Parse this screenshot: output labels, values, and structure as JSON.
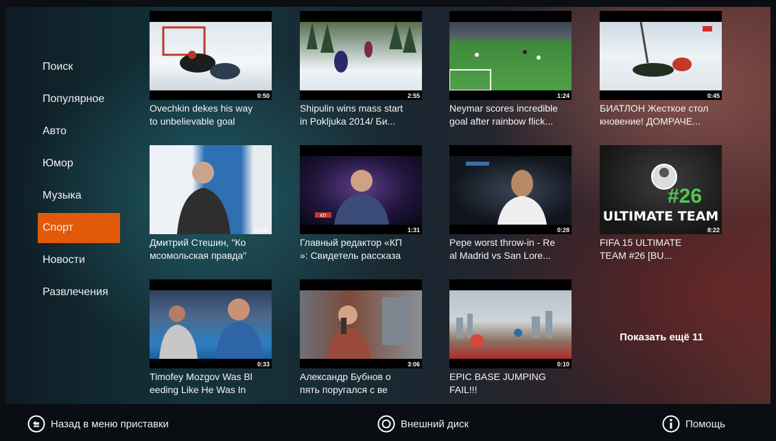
{
  "menu": {
    "items": [
      "Поиск",
      "Популярное",
      "Авто",
      "Юмор",
      "Музыка",
      "Спорт",
      "Новости",
      "Развлечения"
    ],
    "active": "Спорт"
  },
  "videos": [
    {
      "title1": "Ovechkin dekes his way",
      "title2": "to unbelievable goal",
      "duration": "0:50"
    },
    {
      "title1": "Shipulin wins mass start",
      "title2": "in Pokljuka 2014/ Би...",
      "duration": "2:55"
    },
    {
      "title1": "Neymar scores incredible",
      "title2": "goal after rainbow flick...",
      "duration": "1:24"
    },
    {
      "title1": "БИАТЛОН Жесткое стол",
      "title2": "кновение! ДОМРАЧЕ...",
      "duration": "0:45"
    },
    {
      "title1": "Дмитрий Стешин, \"Ко",
      "title2": "мсомольская правда\"",
      "duration": "11:01"
    },
    {
      "title1": "Главный редактор «КП",
      "title2": "»: Свидетель рассказа",
      "duration": "1:31"
    },
    {
      "title1": "Pepe worst throw-in - Re",
      "title2": "al Madrid vs San Lore...",
      "duration": "0:28"
    },
    {
      "title1": "FIFA 15 ULTIMATE",
      "title2": "TEAM #26 [BU...",
      "duration": "8:22"
    },
    {
      "title1": "Timofey Mozgov Was Bl",
      "title2": "eeding Like He Was In",
      "duration": "0:33"
    },
    {
      "title1": "Александр Бубнов о",
      "title2": "пять поругался с ве",
      "duration": "3:06"
    },
    {
      "title1": "EPIC BASE JUMPING",
      "title2": "FAIL!!!",
      "duration": "0:10"
    }
  ],
  "thumb_art": {
    "fifa_number": "#26",
    "fifa_text": "ULTIMATE TEAM",
    "ticker_text": "КП"
  },
  "show_more": "Показать ещё 11",
  "bottom": {
    "back": "Назад в меню приставки",
    "disk": "Внешний диск",
    "help": "Помощь"
  },
  "colors": {
    "accent": "#e15a0a",
    "bottom_bar": "#0a0d12"
  }
}
